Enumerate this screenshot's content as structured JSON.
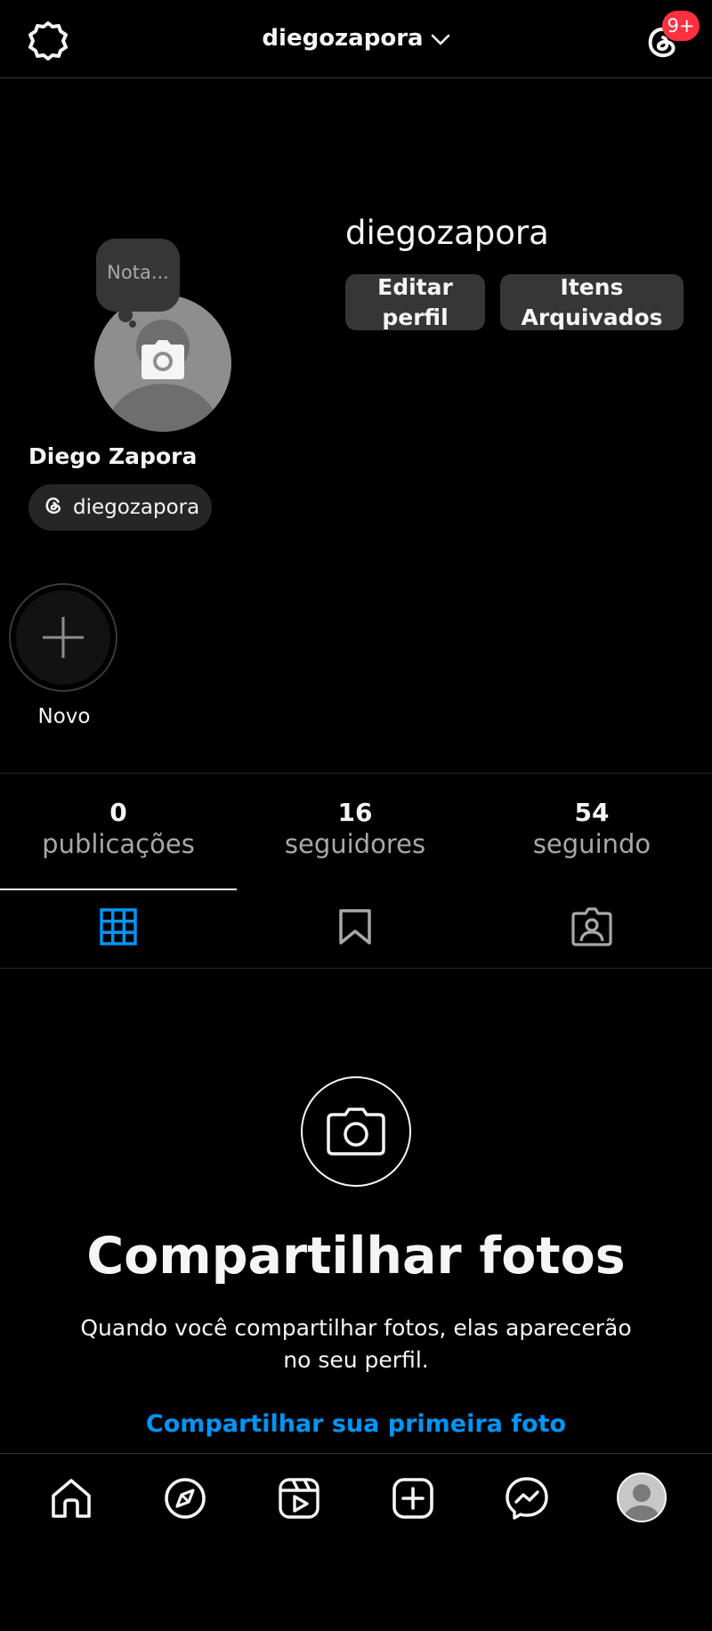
{
  "header": {
    "username": "diegozapora",
    "threads_badge": "9+",
    "icons": {
      "settings": "settings-gear-icon",
      "switch": "chevron-down-icon",
      "threads": "threads-icon"
    }
  },
  "profile": {
    "username": "diegozapora",
    "full_name": "Diego Zapora",
    "note_placeholder": "Nota...",
    "edit_profile_label": "Editar perfil",
    "archived_label": "Itens Arquivados",
    "threads_handle": "diegozapora"
  },
  "highlights": {
    "new_label": "Novo"
  },
  "stats": [
    {
      "value": "0",
      "label": "publicações"
    },
    {
      "value": "16",
      "label": "seguidores"
    },
    {
      "value": "54",
      "label": "seguindo"
    }
  ],
  "tabs": [
    {
      "name": "posts-grid",
      "icon": "grid-icon",
      "active": true
    },
    {
      "name": "saved",
      "icon": "bookmark-icon",
      "active": false
    },
    {
      "name": "tagged",
      "icon": "tagged-user-icon",
      "active": false
    }
  ],
  "empty_state": {
    "title": "Compartilhar fotos",
    "description": "Quando você compartilhar fotos, elas aparecerão no seu perfil.",
    "action": "Compartilhar sua primeira foto"
  },
  "bottom_nav": [
    {
      "name": "home",
      "icon": "home-icon"
    },
    {
      "name": "explore",
      "icon": "compass-icon"
    },
    {
      "name": "reels",
      "icon": "reels-icon"
    },
    {
      "name": "create",
      "icon": "plus-square-icon"
    },
    {
      "name": "messenger",
      "icon": "messenger-icon"
    },
    {
      "name": "profile",
      "icon": "avatar-icon"
    }
  ],
  "colors": {
    "accent": "#0095f6",
    "badge": "#ff3040",
    "background": "#000000",
    "button": "#363636"
  }
}
